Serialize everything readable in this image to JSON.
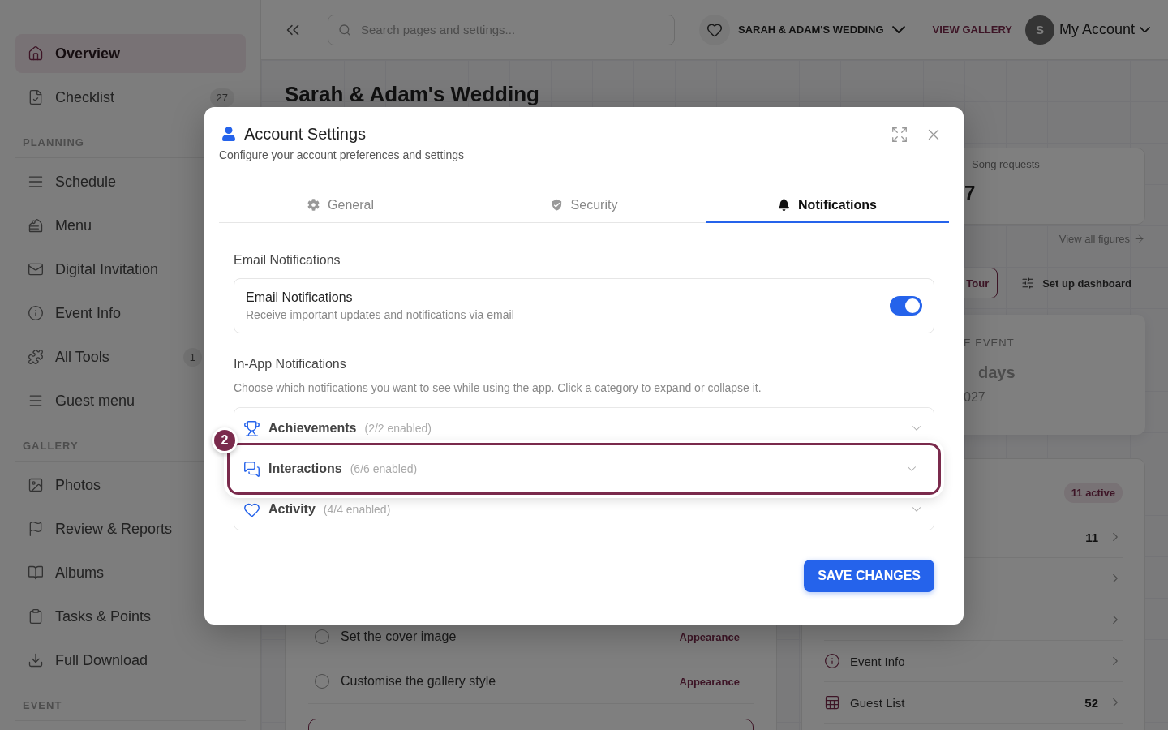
{
  "sidebar": {
    "top_items": [
      {
        "label": "Overview",
        "selected": true
      },
      {
        "label": "Checklist",
        "selected": false,
        "badge": "27"
      }
    ],
    "sections": [
      {
        "label": "PLANNING",
        "items": [
          {
            "label": "Schedule",
            "selected": false
          },
          {
            "label": "Menu",
            "selected": false
          },
          {
            "label": "Digital Invitation",
            "selected": false
          },
          {
            "label": "Event Info",
            "selected": false
          },
          {
            "label": "All Tools",
            "selected": false,
            "badge": "1"
          },
          {
            "label": "Guest menu",
            "selected": false
          }
        ]
      },
      {
        "label": "GALLERY",
        "items": [
          {
            "label": "Photos",
            "selected": false
          },
          {
            "label": "Review & Reports",
            "selected": false
          },
          {
            "label": "Albums",
            "selected": false
          },
          {
            "label": "Tasks & Points",
            "selected": false
          },
          {
            "label": "Full Download",
            "selected": false
          }
        ]
      },
      {
        "label": "EVENT"
      }
    ]
  },
  "topbar": {
    "search": {
      "placeholder": "Search pages and settings..."
    },
    "event_selector": "SARAH & ADAM'S WEDDING",
    "gallery_link": "VIEW GALLERY",
    "account": {
      "initial": "S",
      "label": "My Account"
    }
  },
  "page": {
    "title": "Sarah & Adam's Wedding",
    "stat_card": {
      "label": "Song requests",
      "value": "7"
    },
    "figures_link": "View all figures",
    "actions": [
      {
        "label": "Tour",
        "kind": "outline"
      },
      {
        "label": "Set up dashboard",
        "kind": "plain"
      }
    ],
    "countdown": {
      "heading": "E EVENT",
      "unit": "days",
      "date": "027"
    },
    "guest_card": {
      "badge": "11 active",
      "rows": [
        {
          "count": "11"
        },
        {},
        {},
        {
          "label": "Event Info"
        },
        {
          "label": "Guest List",
          "count": "52"
        }
      ]
    },
    "tasks": [
      {
        "label": "Set the cover image",
        "category": "Appearance",
        "checked": false
      },
      {
        "label": "Customise the gallery style",
        "category": "Appearance",
        "checked": false
      }
    ]
  },
  "modal": {
    "title": "Account Settings",
    "subtitle": "Configure your account preferences and settings",
    "tabs": [
      {
        "label": "General",
        "selected": false
      },
      {
        "label": "Security",
        "selected": false
      },
      {
        "label": "Notifications",
        "selected": true
      }
    ],
    "email_section": {
      "heading": "Email Notifications",
      "card": {
        "title": "Email Notifications",
        "description": "Receive important updates and notifications via email",
        "on": true
      }
    },
    "inapp_section": {
      "heading": "In-App Notifications",
      "description": "Choose which notifications you want to see while using the app. Click a category to expand or collapse it.",
      "categories": [
        {
          "title": "Achievements",
          "count": "(2/2 enabled)",
          "expanded": false,
          "highlighted": false
        },
        {
          "title": "Interactions",
          "count": "(6/6 enabled)",
          "expanded": false,
          "highlighted": true,
          "step": "2"
        },
        {
          "title": "Activity",
          "count": "(4/4 enabled)",
          "expanded": false,
          "highlighted": false
        }
      ]
    },
    "save_button": "SAVE CHANGES"
  }
}
